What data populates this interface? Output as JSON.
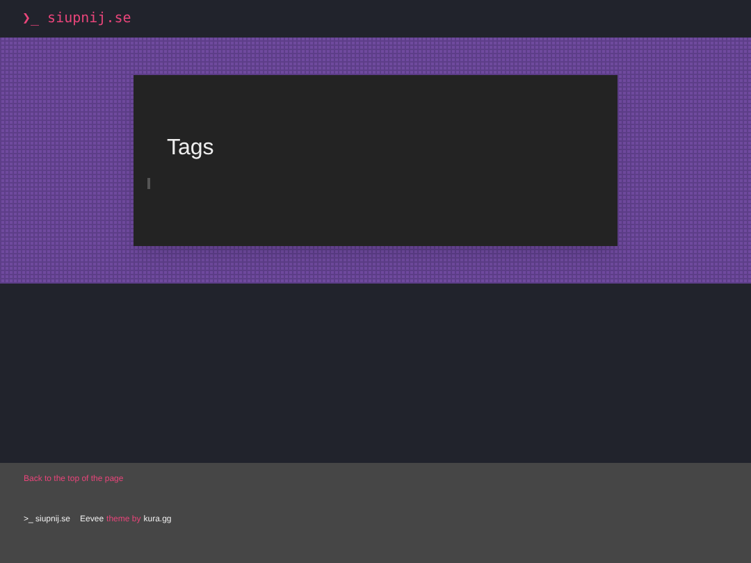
{
  "header": {
    "logo": "❯_ siupnij.se"
  },
  "card": {
    "title": "Tags"
  },
  "footer": {
    "back_link": "Back to the top of the page",
    "site": ">_ siupnij.se",
    "theme": "Eevee",
    "theme_by": "theme by",
    "author": "kura.gg"
  }
}
